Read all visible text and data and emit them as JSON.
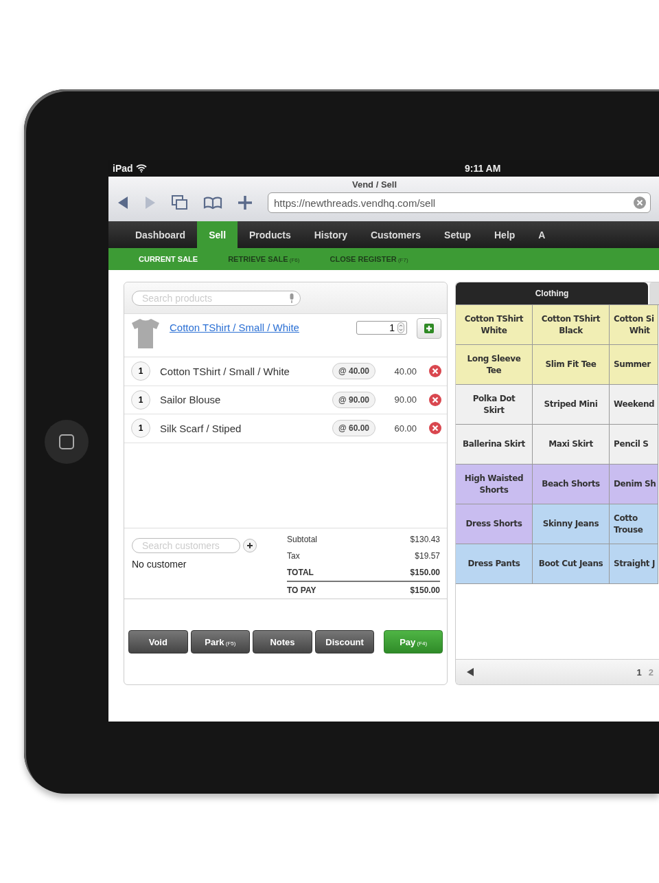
{
  "status_bar": {
    "device": "iPad",
    "time": "9:11 AM"
  },
  "browser": {
    "title": "Vend / Sell",
    "url": "https://newthreads.vendhq.com/sell"
  },
  "nav": [
    {
      "label": "Dashboard",
      "selected": false
    },
    {
      "label": "Sell",
      "selected": true
    },
    {
      "label": "Products",
      "selected": false
    },
    {
      "label": "History",
      "selected": false
    },
    {
      "label": "Customers",
      "selected": false
    },
    {
      "label": "Setup",
      "selected": false
    },
    {
      "label": "Help",
      "selected": false
    },
    {
      "label": "A",
      "selected": false
    }
  ],
  "subnav": [
    {
      "label": "CURRENT SALE",
      "selected": true
    },
    {
      "label": "RETRIEVE SALE",
      "shortcut": "(F6)",
      "selected": false
    },
    {
      "label": "CLOSE REGISTER",
      "shortcut": "(F7)",
      "selected": false
    }
  ],
  "sale": {
    "search_placeholder": "Search products",
    "product": {
      "name": "Cotton TShirt / Small / White",
      "quantity": "1"
    },
    "lines": [
      {
        "qty": "1",
        "name": "Cotton TShirt / Small / White",
        "price": "@ 40.00",
        "total": "40.00"
      },
      {
        "qty": "1",
        "name": "Sailor Blouse",
        "price": "@ 90.00",
        "total": "90.00"
      },
      {
        "qty": "1",
        "name": "Silk Scarf / Stiped",
        "price": "@ 60.00",
        "total": "60.00"
      }
    ],
    "customer": {
      "placeholder": "Search customers",
      "status": "No customer"
    },
    "totals": [
      {
        "label": "Subtotal",
        "value": "$130.43",
        "kind": "normal"
      },
      {
        "label": "Tax",
        "value": "$19.57",
        "kind": "normal"
      },
      {
        "label": "TOTAL",
        "value": "$150.00",
        "kind": "total"
      },
      {
        "label": "TO PAY",
        "value": "$150.00",
        "kind": "total"
      }
    ],
    "buttons": [
      {
        "label": "Void",
        "kind": "dark"
      },
      {
        "label": "Park",
        "shortcut": "(F5)",
        "kind": "dark"
      },
      {
        "label": "Notes",
        "kind": "dark"
      },
      {
        "label": "Discount",
        "kind": "dark"
      },
      {
        "label": "Pay",
        "shortcut": "(F4)",
        "kind": "primary"
      }
    ]
  },
  "catalog": {
    "tabs": [
      {
        "label": "Clothing",
        "selected": true
      }
    ],
    "tiles": [
      {
        "label": "Cotton TShirt\nWhite",
        "color": "#f1eeb4"
      },
      {
        "label": "Cotton TShirt\nBlack",
        "color": "#f1eeb4"
      },
      {
        "label": "Cotton Si\n      Whit",
        "color": "#f1eeb4"
      },
      {
        "label": "Long Sleeve\nTee",
        "color": "#f1eeb4"
      },
      {
        "label": "Slim Fit Tee",
        "color": "#f1eeb4"
      },
      {
        "label": "Summer",
        "color": "#f1eeb4"
      },
      {
        "label": "Polka Dot\nSkirt",
        "color": "#f0f0f0"
      },
      {
        "label": "Striped Mini",
        "color": "#f0f0f0"
      },
      {
        "label": "Weekend",
        "color": "#f0f0f0"
      },
      {
        "label": "Ballerina Skirt",
        "color": "#f0f0f0"
      },
      {
        "label": "Maxi Skirt",
        "color": "#f0f0f0"
      },
      {
        "label": "Pencil S",
        "color": "#f0f0f0"
      },
      {
        "label": "High Waisted\nShorts",
        "color": "#c9bdf0"
      },
      {
        "label": "Beach Shorts",
        "color": "#c9bdf0"
      },
      {
        "label": "Denim Sh",
        "color": "#c9bdf0"
      },
      {
        "label": "Dress Shorts",
        "color": "#c9bdf0"
      },
      {
        "label": "Skinny Jeans",
        "color": "#b9d6f2"
      },
      {
        "label": "Cotto\nTrouse",
        "color": "#b9d6f2"
      },
      {
        "label": "Dress Pants",
        "color": "#b9d6f2"
      },
      {
        "label": "Boot Cut Jeans",
        "color": "#b9d6f2"
      },
      {
        "label": "Straight J",
        "color": "#b9d6f2"
      }
    ],
    "pages": [
      {
        "label": "1",
        "selected": true
      },
      {
        "label": "2",
        "selected": false
      }
    ]
  }
}
